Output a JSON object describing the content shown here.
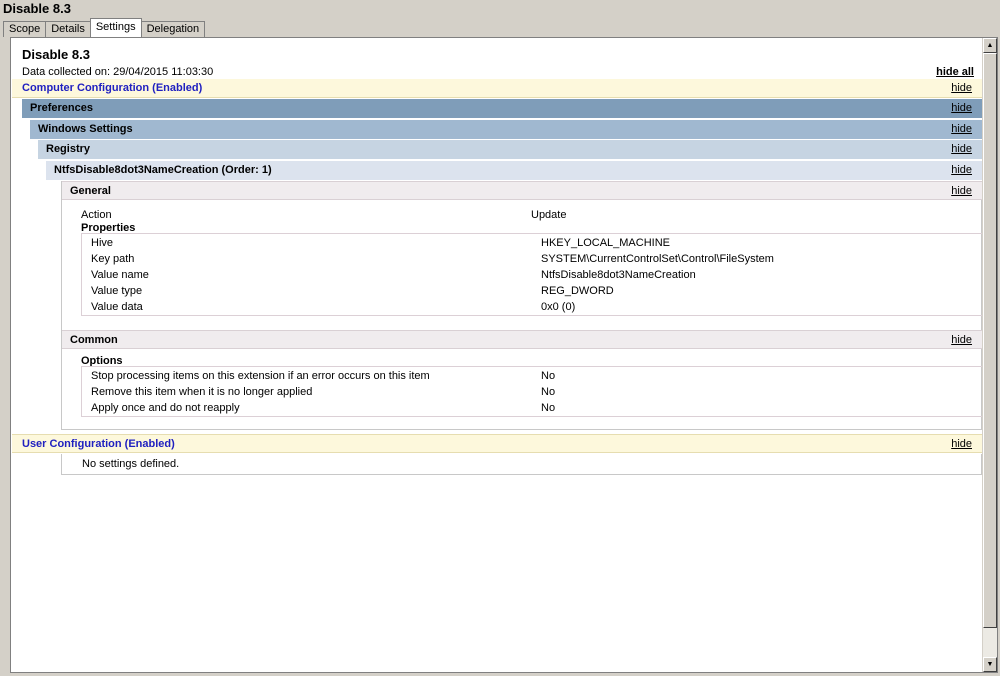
{
  "window": {
    "title": "Disable 8.3"
  },
  "tabs": [
    {
      "label": "Scope"
    },
    {
      "label": "Details"
    },
    {
      "label": "Settings"
    },
    {
      "label": "Delegation"
    }
  ],
  "report": {
    "title": "Disable 8.3",
    "collected": "Data collected on: 29/04/2015 11:03:30",
    "hide_all": "hide all",
    "hide": "hide"
  },
  "computer": {
    "label": "Computer Configuration (Enabled)",
    "preferences": "Preferences",
    "windows_settings": "Windows Settings",
    "registry": "Registry",
    "item": "NtfsDisable8dot3NameCreation (Order: 1)",
    "general": {
      "label": "General",
      "action_label": "Action",
      "action_value": "Update",
      "properties_label": "Properties",
      "properties": [
        {
          "name": "Hive",
          "value": "HKEY_LOCAL_MACHINE"
        },
        {
          "name": "Key path",
          "value": "SYSTEM\\CurrentControlSet\\Control\\FileSystem"
        },
        {
          "name": "Value name",
          "value": "NtfsDisable8dot3NameCreation"
        },
        {
          "name": "Value type",
          "value": "REG_DWORD"
        },
        {
          "name": "Value data",
          "value": "0x0 (0)"
        }
      ]
    },
    "common": {
      "label": "Common",
      "options_label": "Options",
      "options": [
        {
          "name": "Stop processing items on this extension if an error occurs on this item",
          "value": "No"
        },
        {
          "name": "Remove this item when it is no longer applied",
          "value": "No"
        },
        {
          "name": "Apply once and do not reapply",
          "value": "No"
        }
      ]
    }
  },
  "user": {
    "label": "User Configuration (Enabled)",
    "no_settings": "No settings defined."
  },
  "icons": {
    "scroll_up": "scroll-up-arrow-icon",
    "scroll_down": "scroll-down-arrow-icon"
  }
}
